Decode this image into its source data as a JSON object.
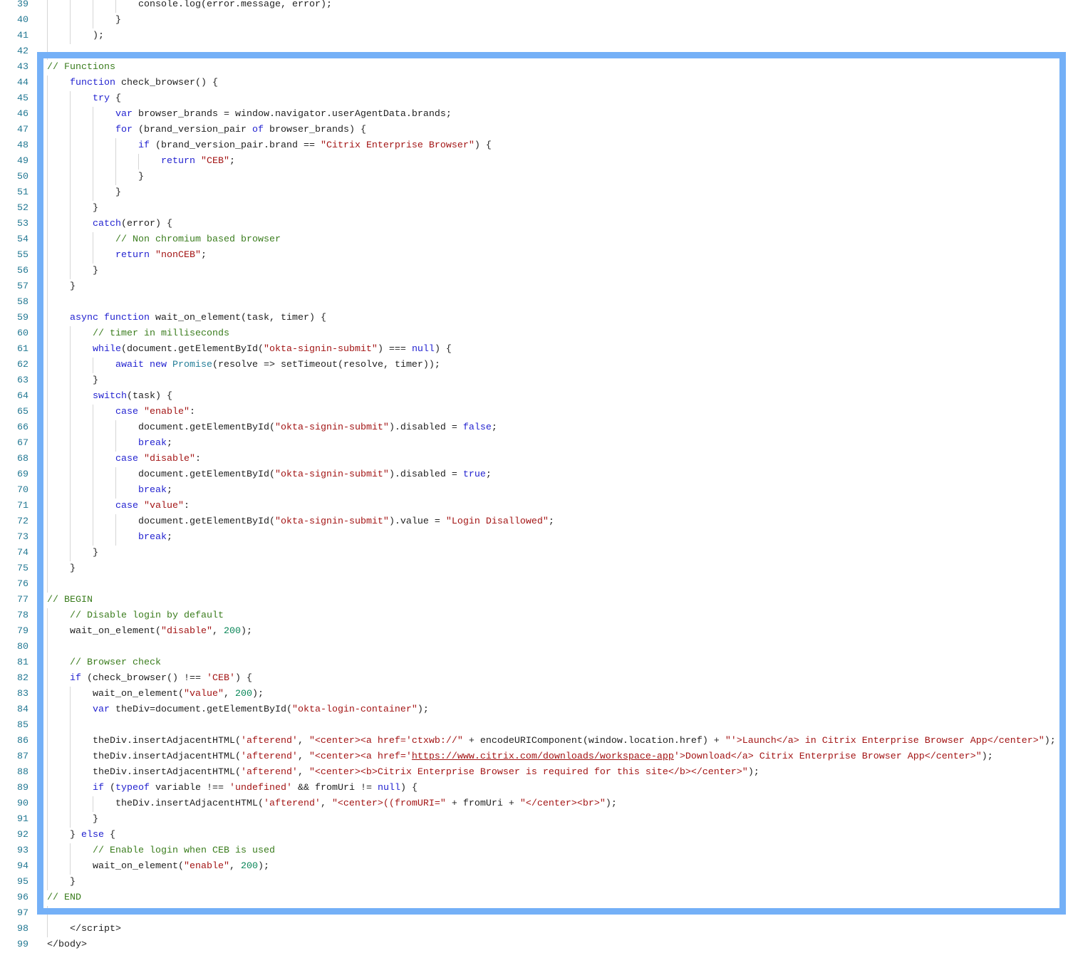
{
  "colors": {
    "highlight": "#74b0f7",
    "keyword": "#2323d0",
    "string": "#a31515",
    "comment": "#3b7d1e",
    "number": "#098658",
    "line_number": "#237893"
  },
  "lines": [
    [
      39,
      4,
      [
        [
          "p",
          "console.log(error.message, error);"
        ]
      ]
    ],
    [
      40,
      3,
      [
        [
          "p",
          "}"
        ]
      ]
    ],
    [
      41,
      2,
      [
        [
          "p",
          ");"
        ]
      ]
    ],
    [
      42,
      1,
      []
    ],
    [
      43,
      0,
      [
        [
          "c",
          "// Functions"
        ]
      ]
    ],
    [
      44,
      1,
      [
        [
          "k",
          "function"
        ],
        [
          "p",
          " check_browser() {"
        ]
      ]
    ],
    [
      45,
      2,
      [
        [
          "k",
          "try"
        ],
        [
          "p",
          " {"
        ]
      ]
    ],
    [
      46,
      3,
      [
        [
          "k",
          "var"
        ],
        [
          "p",
          " browser_brands = window.navigator.userAgentData.brands;"
        ]
      ]
    ],
    [
      47,
      3,
      [
        [
          "k",
          "for"
        ],
        [
          "p",
          " (brand_version_pair "
        ],
        [
          "k",
          "of"
        ],
        [
          "p",
          " browser_brands) {"
        ]
      ]
    ],
    [
      48,
      4,
      [
        [
          "k",
          "if"
        ],
        [
          "p",
          " (brand_version_pair.brand == "
        ],
        [
          "s",
          "\"Citrix Enterprise Browser\""
        ],
        [
          "p",
          ") {"
        ]
      ]
    ],
    [
      49,
      5,
      [
        [
          "k",
          "return"
        ],
        [
          "p",
          " "
        ],
        [
          "s",
          "\"CEB\""
        ],
        [
          "p",
          ";"
        ]
      ]
    ],
    [
      50,
      4,
      [
        [
          "p",
          "}"
        ]
      ]
    ],
    [
      51,
      3,
      [
        [
          "p",
          "}"
        ]
      ]
    ],
    [
      52,
      2,
      [
        [
          "p",
          "}"
        ]
      ]
    ],
    [
      53,
      2,
      [
        [
          "k",
          "catch"
        ],
        [
          "p",
          "(error) {"
        ]
      ]
    ],
    [
      54,
      3,
      [
        [
          "c",
          "// Non chromium based browser"
        ]
      ]
    ],
    [
      55,
      3,
      [
        [
          "k",
          "return"
        ],
        [
          "p",
          " "
        ],
        [
          "s",
          "\"nonCEB\""
        ],
        [
          "p",
          ";"
        ]
      ]
    ],
    [
      56,
      2,
      [
        [
          "p",
          "}"
        ]
      ]
    ],
    [
      57,
      1,
      [
        [
          "p",
          "}"
        ]
      ]
    ],
    [
      58,
      1,
      []
    ],
    [
      59,
      1,
      [
        [
          "k",
          "async"
        ],
        [
          "p",
          " "
        ],
        [
          "k",
          "function"
        ],
        [
          "p",
          " wait_on_element(task, timer) {"
        ]
      ]
    ],
    [
      60,
      2,
      [
        [
          "c",
          "// timer in milliseconds"
        ]
      ]
    ],
    [
      61,
      2,
      [
        [
          "k",
          "while"
        ],
        [
          "p",
          "(document.getElementById("
        ],
        [
          "s",
          "\"okta-signin-submit\""
        ],
        [
          "p",
          ") === "
        ],
        [
          "k",
          "null"
        ],
        [
          "p",
          ") {"
        ]
      ]
    ],
    [
      62,
      3,
      [
        [
          "k",
          "await"
        ],
        [
          "p",
          " "
        ],
        [
          "k",
          "new"
        ],
        [
          "p",
          " "
        ],
        [
          "t",
          "Promise"
        ],
        [
          "p",
          "(resolve => setTimeout(resolve, timer));"
        ]
      ]
    ],
    [
      63,
      2,
      [
        [
          "p",
          "}"
        ]
      ]
    ],
    [
      64,
      2,
      [
        [
          "k",
          "switch"
        ],
        [
          "p",
          "(task) {"
        ]
      ]
    ],
    [
      65,
      3,
      [
        [
          "k",
          "case"
        ],
        [
          "p",
          " "
        ],
        [
          "s",
          "\"enable\""
        ],
        [
          "p",
          ":"
        ]
      ]
    ],
    [
      66,
      4,
      [
        [
          "p",
          "document.getElementById("
        ],
        [
          "s",
          "\"okta-signin-submit\""
        ],
        [
          "p",
          ").disabled = "
        ],
        [
          "k",
          "false"
        ],
        [
          "p",
          ";"
        ]
      ]
    ],
    [
      67,
      4,
      [
        [
          "k",
          "break"
        ],
        [
          "p",
          ";"
        ]
      ]
    ],
    [
      68,
      3,
      [
        [
          "k",
          "case"
        ],
        [
          "p",
          " "
        ],
        [
          "s",
          "\"disable\""
        ],
        [
          "p",
          ":"
        ]
      ]
    ],
    [
      69,
      4,
      [
        [
          "p",
          "document.getElementById("
        ],
        [
          "s",
          "\"okta-signin-submit\""
        ],
        [
          "p",
          ").disabled = "
        ],
        [
          "k",
          "true"
        ],
        [
          "p",
          ";"
        ]
      ]
    ],
    [
      70,
      4,
      [
        [
          "k",
          "break"
        ],
        [
          "p",
          ";"
        ]
      ]
    ],
    [
      71,
      3,
      [
        [
          "k",
          "case"
        ],
        [
          "p",
          " "
        ],
        [
          "s",
          "\"value\""
        ],
        [
          "p",
          ":"
        ]
      ]
    ],
    [
      72,
      4,
      [
        [
          "p",
          "document.getElementById("
        ],
        [
          "s",
          "\"okta-signin-submit\""
        ],
        [
          "p",
          ").value = "
        ],
        [
          "s",
          "\"Login Disallowed\""
        ],
        [
          "p",
          ";"
        ]
      ]
    ],
    [
      73,
      4,
      [
        [
          "k",
          "break"
        ],
        [
          "p",
          ";"
        ]
      ]
    ],
    [
      74,
      2,
      [
        [
          "p",
          "}"
        ]
      ]
    ],
    [
      75,
      1,
      [
        [
          "p",
          "}"
        ]
      ]
    ],
    [
      76,
      1,
      []
    ],
    [
      77,
      0,
      [
        [
          "c",
          "// BEGIN"
        ]
      ]
    ],
    [
      78,
      1,
      [
        [
          "c",
          "// Disable login by default"
        ]
      ]
    ],
    [
      79,
      1,
      [
        [
          "p",
          "wait_on_element("
        ],
        [
          "s",
          "\"disable\""
        ],
        [
          "p",
          ", "
        ],
        [
          "n",
          "200"
        ],
        [
          "p",
          ");"
        ]
      ]
    ],
    [
      80,
      1,
      []
    ],
    [
      81,
      1,
      [
        [
          "c",
          "// Browser check"
        ]
      ]
    ],
    [
      82,
      1,
      [
        [
          "k",
          "if"
        ],
        [
          "p",
          " (check_browser() !== "
        ],
        [
          "s",
          "'CEB'"
        ],
        [
          "p",
          ") {"
        ]
      ]
    ],
    [
      83,
      2,
      [
        [
          "p",
          "wait_on_element("
        ],
        [
          "s",
          "\"value\""
        ],
        [
          "p",
          ", "
        ],
        [
          "n",
          "200"
        ],
        [
          "p",
          ");"
        ]
      ]
    ],
    [
      84,
      2,
      [
        [
          "k",
          "var"
        ],
        [
          "p",
          " theDiv=document.getElementById("
        ],
        [
          "s",
          "\"okta-login-container\""
        ],
        [
          "p",
          ");"
        ]
      ]
    ],
    [
      85,
      2,
      []
    ],
    [
      86,
      2,
      [
        [
          "p",
          "theDiv.insertAdjacentHTML("
        ],
        [
          "s",
          "'afterend'"
        ],
        [
          "p",
          ", "
        ],
        [
          "s",
          "\"<center><a href='ctxwb://\""
        ],
        [
          "p",
          " + encodeURIComponent(window.location.href) + "
        ],
        [
          "s",
          "\"'>Launch</a> in Citrix Enterprise Browser App</center>\""
        ],
        [
          "p",
          ");"
        ]
      ]
    ],
    [
      87,
      2,
      [
        [
          "p",
          "theDiv.insertAdjacentHTML("
        ],
        [
          "s",
          "'afterend'"
        ],
        [
          "p",
          ", "
        ],
        [
          "s",
          "\"<center><a href='"
        ],
        [
          "u",
          "https://www.citrix.com/downloads/workspace-app"
        ],
        [
          "s",
          "'>Download</a> Citrix Enterprise Browser App</center>\""
        ],
        [
          "p",
          ");"
        ]
      ]
    ],
    [
      88,
      2,
      [
        [
          "p",
          "theDiv.insertAdjacentHTML("
        ],
        [
          "s",
          "'afterend'"
        ],
        [
          "p",
          ", "
        ],
        [
          "s",
          "\"<center><b>Citrix Enterprise Browser is required for this site</b></center>\""
        ],
        [
          "p",
          ");"
        ]
      ]
    ],
    [
      89,
      2,
      [
        [
          "k",
          "if"
        ],
        [
          "p",
          " ("
        ],
        [
          "k",
          "typeof"
        ],
        [
          "p",
          " variable !== "
        ],
        [
          "s",
          "'undefined'"
        ],
        [
          "p",
          " && fromUri != "
        ],
        [
          "k",
          "null"
        ],
        [
          "p",
          ") {"
        ]
      ]
    ],
    [
      90,
      3,
      [
        [
          "p",
          "theDiv.insertAdjacentHTML("
        ],
        [
          "s",
          "'afterend'"
        ],
        [
          "p",
          ", "
        ],
        [
          "s",
          "\"<center>((fromURI=\""
        ],
        [
          "p",
          " + fromUri + "
        ],
        [
          "s",
          "\"</center><br>\""
        ],
        [
          "p",
          ");"
        ]
      ]
    ],
    [
      91,
      2,
      [
        [
          "p",
          "}"
        ]
      ]
    ],
    [
      92,
      1,
      [
        [
          "p",
          "} "
        ],
        [
          "k",
          "else"
        ],
        [
          "p",
          " {"
        ]
      ]
    ],
    [
      93,
      2,
      [
        [
          "c",
          "// Enable login when CEB is used"
        ]
      ]
    ],
    [
      94,
      2,
      [
        [
          "p",
          "wait_on_element("
        ],
        [
          "s",
          "\"enable\""
        ],
        [
          "p",
          ", "
        ],
        [
          "n",
          "200"
        ],
        [
          "p",
          ");"
        ]
      ]
    ],
    [
      95,
      1,
      [
        [
          "p",
          "}"
        ]
      ]
    ],
    [
      96,
      0,
      [
        [
          "c",
          "// END"
        ]
      ]
    ],
    [
      97,
      1,
      []
    ],
    [
      98,
      1,
      [
        [
          "p",
          "</script>"
        ]
      ]
    ],
    [
      99,
      0,
      [
        [
          "p",
          "</body>"
        ]
      ]
    ]
  ]
}
